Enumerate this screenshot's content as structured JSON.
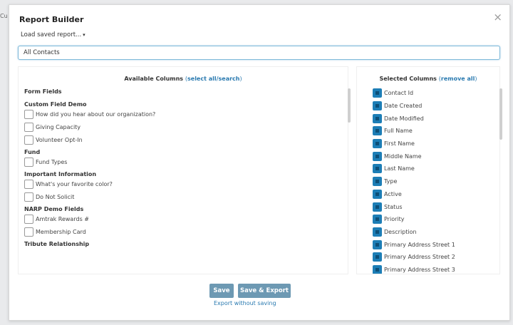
{
  "background": {
    "edge_text": "Cu"
  },
  "modal": {
    "title": "Report Builder",
    "close_icon": "×",
    "load_saved": "Load saved report...",
    "load_caret": "▾",
    "report_name_value": "All Contacts"
  },
  "available": {
    "header": "Available Columns",
    "header_link": "select all/search",
    "section": "Form Fields",
    "groups": [
      {
        "title": "Custom Field Demo",
        "items": [
          "How did you hear about our organization?",
          "Giving Capacity",
          "Volunteer Opt-In"
        ]
      },
      {
        "title": "Fund",
        "items": [
          "Fund Types"
        ]
      },
      {
        "title": "Important Information",
        "items": [
          "What's your favorite color?",
          "Do Not Solicit"
        ]
      },
      {
        "title": "NARP Demo Fields",
        "items": [
          "Amtrak Rewards #",
          "Membership Card"
        ]
      },
      {
        "title": "Tribute Relationship",
        "items": []
      }
    ]
  },
  "selected": {
    "header": "Selected Columns",
    "header_link": "remove all",
    "items": [
      "Contact Id",
      "Date Created",
      "Date Modified",
      "Full Name",
      "First Name",
      "Middle Name",
      "Last Name",
      "Type",
      "Active",
      "Status",
      "Priority",
      "Description",
      "Primary Address Street 1",
      "Primary Address Street 2",
      "Primary Address Street 3"
    ]
  },
  "actions": {
    "save": "Save",
    "save_export": "Save & Export",
    "export_without_saving": "Export without saving"
  },
  "colors": {
    "accent": "#1d7eb6",
    "button": "#6d99b3",
    "link": "#2a7ab0"
  }
}
